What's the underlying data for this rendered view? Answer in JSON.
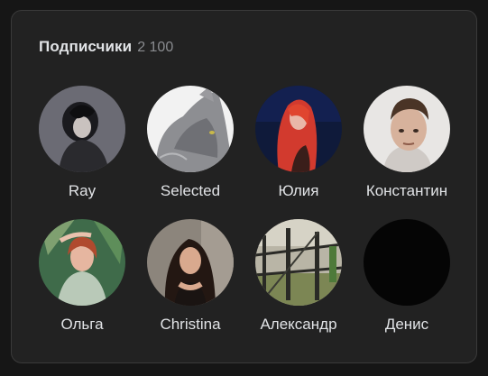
{
  "subscribers": {
    "title": "Подписчики",
    "count": "2 100",
    "members": [
      {
        "name": "Ray",
        "avatar_icon": "person-photo-icon"
      },
      {
        "name": "Selected",
        "avatar_icon": "cat-photo-icon"
      },
      {
        "name": "Юлия",
        "avatar_icon": "person-photo-icon"
      },
      {
        "name": "Константин",
        "avatar_icon": "person-photo-icon"
      },
      {
        "name": "Ольга",
        "avatar_icon": "person-photo-icon"
      },
      {
        "name": "Christina",
        "avatar_icon": "person-photo-icon"
      },
      {
        "name": "Александр",
        "avatar_icon": "landscape-photo-icon"
      },
      {
        "name": "Денис",
        "avatar_icon": "empty-avatar-icon"
      }
    ]
  },
  "colors": {
    "page_background": "#161616",
    "card_background": "#222222",
    "card_border": "#3a3a3a",
    "text_primary": "#e1e3e6",
    "text_secondary": "#8a8c90"
  }
}
